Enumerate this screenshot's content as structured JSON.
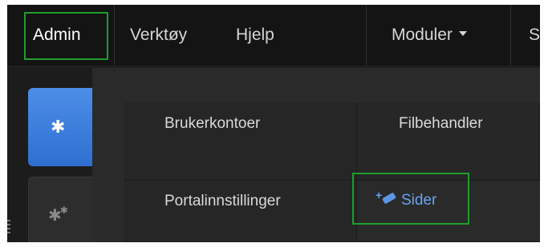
{
  "menu": {
    "admin": "Admin",
    "tools": "Verktøy",
    "help": "Hjelp",
    "modules": "Moduler",
    "cut_item": "S"
  },
  "sidebar": {
    "tabs": [
      {
        "icon": "gear-icon",
        "active": true
      },
      {
        "icon": "gears-icon",
        "active": false
      }
    ]
  },
  "admin_panel": {
    "items": [
      {
        "label": "Brukerkontoer"
      },
      {
        "label": "Filbehandler"
      },
      {
        "label": "Portalinnstillinger"
      },
      {
        "label": "Sider"
      }
    ]
  },
  "colors": {
    "highlight": "#1e9e2e",
    "accent": "#4d8ee8",
    "link": "#6aa3f0"
  }
}
